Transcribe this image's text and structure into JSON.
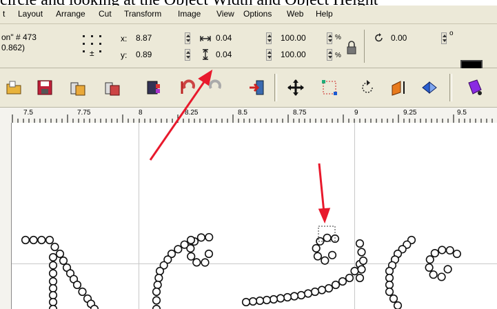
{
  "caption": "circle and looking at the Object Width and Object Height",
  "menu": [
    "t",
    "Layout",
    "Arrange",
    "Cut",
    "Transform",
    "Image",
    "View",
    "Options",
    "Web",
    "Help"
  ],
  "property_bar": {
    "object_name": "on\" # 473",
    "object_sub": "0.862)",
    "x_label": "x:",
    "x_value": "8.87",
    "y_label": "y:",
    "y_value": "0.89",
    "width_value": "0.04",
    "height_value": "0.04",
    "scale_x": "100.00",
    "scale_y": "100.00",
    "percent": "%",
    "rotation_value": "0.00",
    "degree": "o"
  },
  "toolbar_icons": [
    "open-folder-icon",
    "save-icon",
    "import-icon",
    "export-icon",
    "image-icon",
    "undo-icon",
    "redo-icon",
    "exit-icon",
    "move-icon",
    "bounding-box-icon",
    "rotate-icon",
    "skew-icon",
    "mirror-icon",
    "color-icon"
  ],
  "ruler_labels": [
    "7.5",
    "7.75",
    "8",
    "8.25",
    "8.5",
    "8.75",
    "9",
    "9.25",
    "9.5"
  ],
  "colors": {
    "chrome": "#ece9d8",
    "field_border": "#7f9db9",
    "arrow": "#e8192c"
  }
}
